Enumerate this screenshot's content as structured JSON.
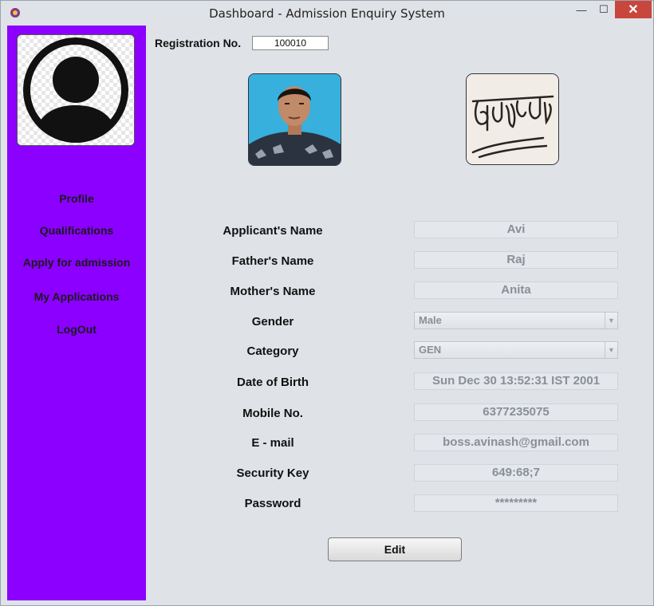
{
  "window": {
    "title": "Dashboard - Admission Enquiry System",
    "controls": {
      "minimize": "—",
      "maximize": "☐",
      "close": "✕"
    }
  },
  "sidebar": {
    "avatar_icon": "user-avatar-icon",
    "items": [
      {
        "label": "Profile"
      },
      {
        "label": "Qualifications"
      },
      {
        "label": "Apply for admission"
      },
      {
        "label": "My Applications"
      },
      {
        "label": "LogOut"
      }
    ],
    "bg_color": "#8b00ff"
  },
  "registration": {
    "label": "Registration No.",
    "value": "100010"
  },
  "photo": {
    "icon": "applicant-photo"
  },
  "signature": {
    "icon": "applicant-signature"
  },
  "form": {
    "applicant_name": {
      "label": "Applicant's Name",
      "value": "Avi"
    },
    "father_name": {
      "label": "Father's Name",
      "value": "Raj"
    },
    "mother_name": {
      "label": "Mother's Name",
      "value": "Anita"
    },
    "gender": {
      "label": "Gender",
      "value": "Male"
    },
    "category": {
      "label": "Category",
      "value": "GEN"
    },
    "dob": {
      "label": "Date of Birth",
      "value": "Sun Dec 30 13:52:31 IST 2001"
    },
    "mobile": {
      "label": "Mobile No.",
      "value": "6377235075"
    },
    "email": {
      "label": "E - mail",
      "value": "boss.avinash@gmail.com"
    },
    "security_key": {
      "label": "Security Key",
      "value": "649:68;7"
    },
    "password": {
      "label": "Password",
      "value": "*********"
    }
  },
  "edit_button": {
    "label": "Edit"
  }
}
